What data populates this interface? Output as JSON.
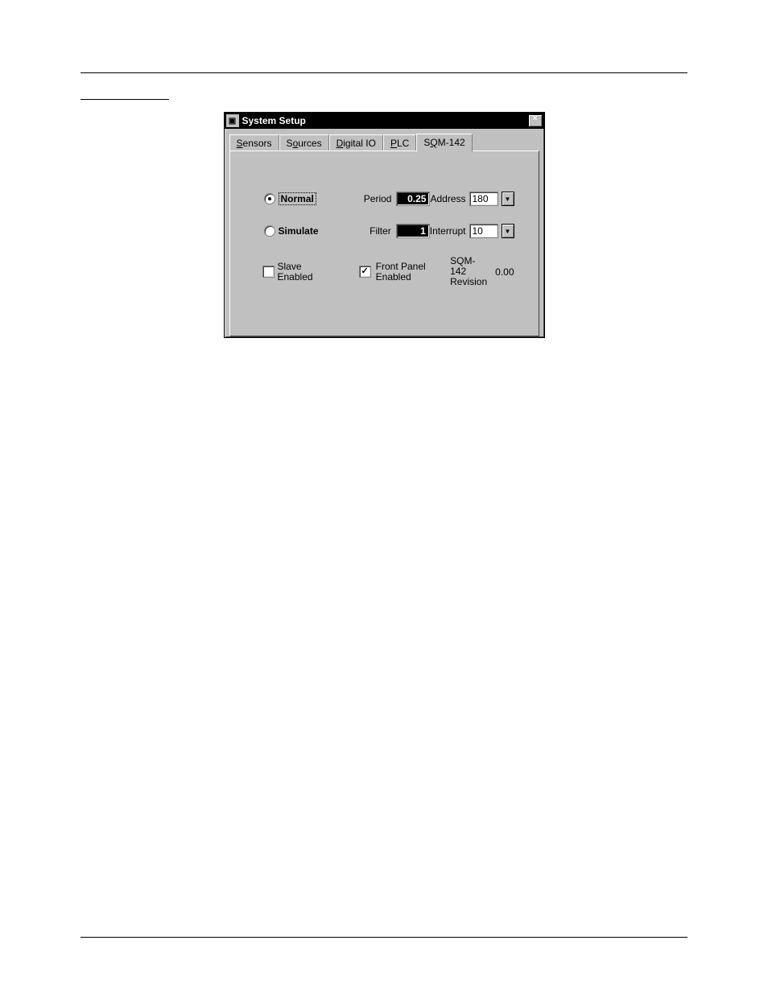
{
  "window": {
    "title": "System Setup",
    "close_label": "×"
  },
  "tabs": {
    "sensors": "Sensors",
    "sources": "Sources",
    "digitalio": "Digital IO",
    "plc": "PLC",
    "sqm142": "SQM-142"
  },
  "radios": {
    "normal": "Normal",
    "simulate": "Simulate"
  },
  "fields": {
    "period_label": "Period",
    "period_value": "0.25",
    "filter_label": "Filter",
    "filter_value": "1",
    "address_label": "Address",
    "address_value": "180",
    "interrupt_label": "Interrupt",
    "interrupt_value": "10"
  },
  "checkboxes": {
    "slave_line1": "Slave",
    "slave_line2": "Enabled",
    "front_line1": "Front Panel",
    "front_line2": "Enabled"
  },
  "revision": {
    "line1": "SQM-142",
    "line2": "Revision",
    "value": "0.00"
  }
}
